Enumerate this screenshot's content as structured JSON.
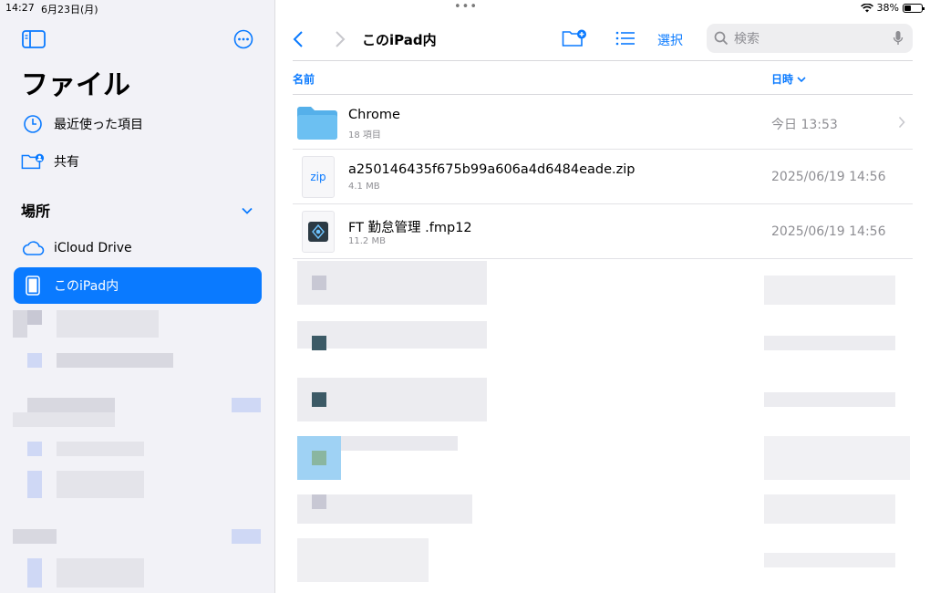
{
  "status": {
    "time": "14:27",
    "date": "6月23日(月)",
    "dots": "•••",
    "battery": "38%"
  },
  "sidebar": {
    "title": "ファイル",
    "items": [
      {
        "label": "最近使った項目",
        "icon": "clock-icon"
      },
      {
        "label": "共有",
        "icon": "shared-folder-icon"
      }
    ],
    "section": "場所",
    "locations": [
      {
        "label": "iCloud Drive",
        "icon": "cloud-icon"
      },
      {
        "label": "このiPad内",
        "icon": "ipad-icon",
        "active": true
      }
    ]
  },
  "nav": {
    "title": "このiPad内",
    "select": "選択",
    "search_placeholder": "検索"
  },
  "columns": {
    "name": "名前",
    "date": "日時"
  },
  "files": [
    {
      "name": "Chrome",
      "sub": "18 項目",
      "date": "今日 13:53",
      "kind": "folder"
    },
    {
      "name": "a250146435f675b99a606a4d6484eade.zip",
      "sub": "4.1 MB",
      "date": "2025/06/19 14:56",
      "kind": "zip",
      "badge": "zip"
    },
    {
      "name": "FT 勤怠管理 .fmp12",
      "sub": "11.2 MB",
      "date": "2025/06/19 14:56",
      "kind": "fmp"
    }
  ],
  "colors": {
    "accent": "#0a7aff",
    "sidebar_bg": "#f2f2f7"
  }
}
